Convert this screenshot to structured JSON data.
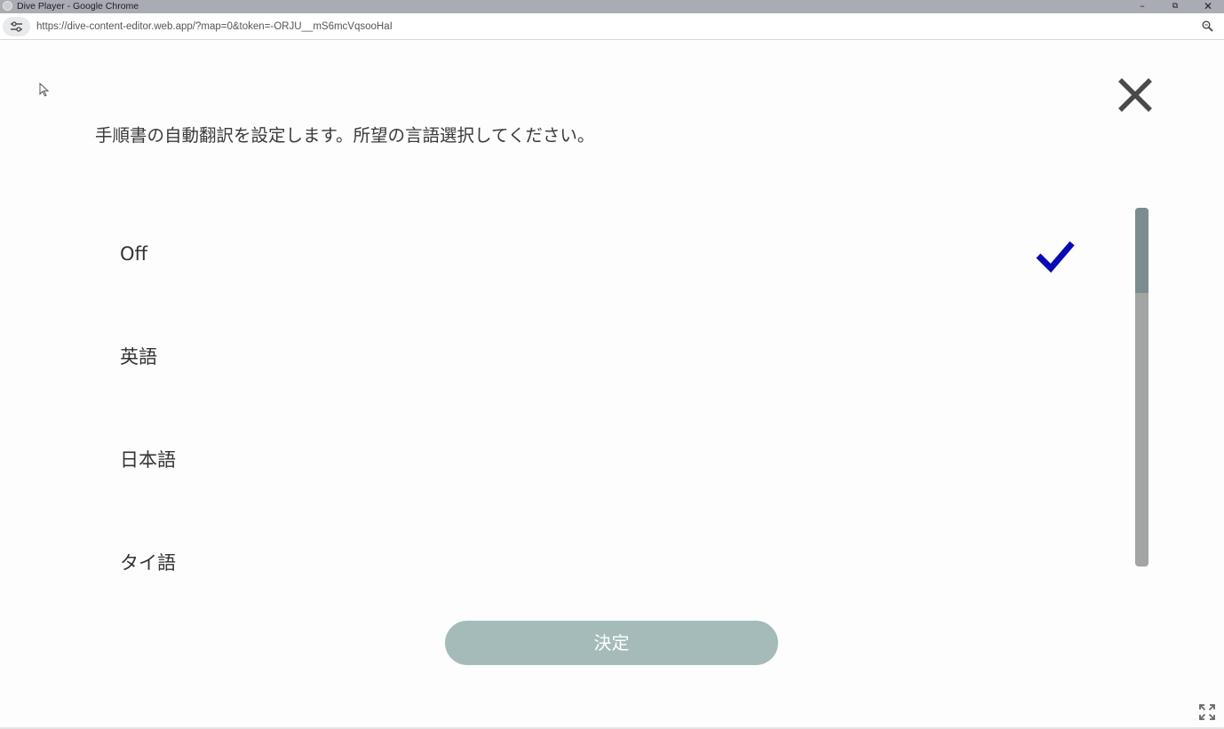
{
  "window": {
    "title": "Dive Player - Google Chrome",
    "minimize": "–",
    "restore": "⧉",
    "close": "✕"
  },
  "address_bar": {
    "url": "https://dive-content-editor.web.app/?map=0&token=-ORJU__mS6mcVqsooHaI"
  },
  "dialog": {
    "instruction": "手順書の自動翻訳を設定します。所望の言語選択してください。",
    "options": [
      {
        "label": "Off",
        "selected": true
      },
      {
        "label": "英語",
        "selected": false
      },
      {
        "label": "日本語",
        "selected": false
      },
      {
        "label": "タイ語",
        "selected": false
      }
    ],
    "confirm_label": "決定"
  },
  "colors": {
    "check": "#0a0ab4",
    "confirm_button": "#a5bbb9",
    "scroll_thumb": "#7b8d90",
    "scroll_track": "#a3a5a4"
  },
  "icons": [
    "app-icon",
    "site-settings-icon",
    "zoom-icon",
    "cursor-icon",
    "close-icon",
    "checkmark-icon",
    "fullscreen-icon"
  ]
}
